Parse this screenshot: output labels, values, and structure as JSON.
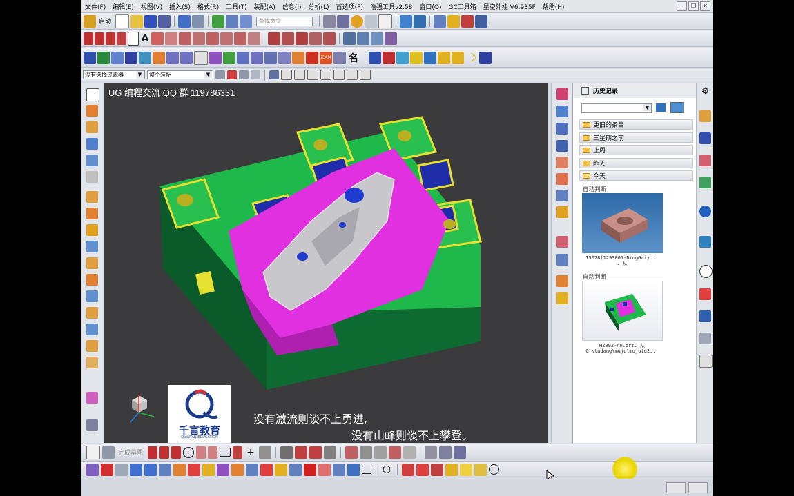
{
  "menubar": {
    "items": [
      "文件(F)",
      "编辑(E)",
      "视图(V)",
      "插入(S)",
      "格式(R)",
      "工具(T)",
      "装配(A)",
      "信息(I)",
      "分析(L)",
      "首选项(P)",
      "浩强工具v2.58",
      "窗口(O)",
      "GC工具箱",
      "星空外挂 V6.935F",
      "帮助(H)"
    ]
  },
  "toolbar1": {
    "start_label": "启动",
    "search_placeholder": "查找命令"
  },
  "filterbar": {
    "filter_value": "没有选择过滤器",
    "scope_value": "整个装配"
  },
  "viewport": {
    "title": "UG 编程交流 QQ 群 119786331",
    "caption_line1": "没有激流则谈不上勇进,",
    "caption_line2": "没有山峰则谈不上攀登。",
    "logo_name": "千言教育",
    "logo_sub": "QIANYAN EDUCATION"
  },
  "history": {
    "title": "历史记录",
    "folders": [
      "更旧的条目",
      "三星期之前",
      "上周",
      "昨天",
      "今天"
    ],
    "entries": [
      {
        "label": "自动判断",
        "file_line1": "15028(1293001-DingGai)...",
        "file_line2": ". 从"
      },
      {
        "label": "自动判断",
        "file_line1": "HZ092-A0.prt. 从",
        "file_line2": "G:\\tudang\\muju\\mujutu2..."
      }
    ]
  },
  "bottombar": {
    "sketch_label": "完成草图"
  },
  "toolbar2": {
    "name_label": "名"
  },
  "colors": {
    "mold_green": "#1fb84a",
    "mold_dark_green": "#0b5a2a",
    "magenta": "#e030e0",
    "yellow": "#e6e030",
    "blue": "#1f2ea8",
    "viewport_bg": "#3b3b3d"
  }
}
